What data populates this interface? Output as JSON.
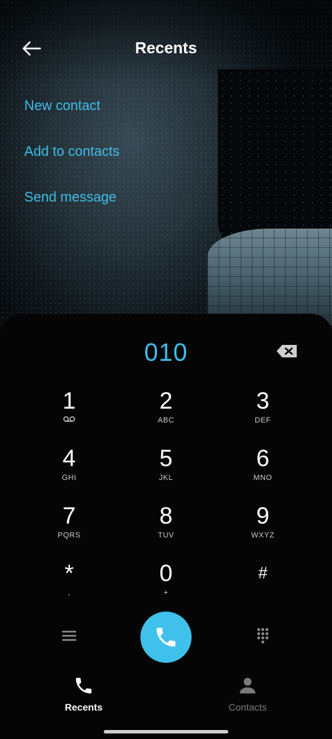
{
  "header": {
    "title": "Recents",
    "back_icon": "arrow-left-icon"
  },
  "menu": {
    "items": [
      {
        "label": "New contact"
      },
      {
        "label": "Add to contacts"
      },
      {
        "label": "Send message"
      }
    ]
  },
  "dialer": {
    "number": "010",
    "backspace_icon": "backspace-icon",
    "keys": [
      {
        "digit": "1",
        "letters": ""
      },
      {
        "digit": "2",
        "letters": "ABC"
      },
      {
        "digit": "3",
        "letters": "DEF"
      },
      {
        "digit": "4",
        "letters": "GHI"
      },
      {
        "digit": "5",
        "letters": "JKL"
      },
      {
        "digit": "6",
        "letters": "MNO"
      },
      {
        "digit": "7",
        "letters": "PQRS"
      },
      {
        "digit": "8",
        "letters": "TUV"
      },
      {
        "digit": "9",
        "letters": "WXYZ"
      },
      {
        "digit": "*",
        "letters": ","
      },
      {
        "digit": "0",
        "letters": "+"
      },
      {
        "digit": "#",
        "letters": ""
      }
    ],
    "menu_icon": "hamburger-menu-icon",
    "call_icon": "phone-icon",
    "keypad_icon": "dialpad-icon"
  },
  "bottom_nav": {
    "recents": {
      "label": "Recents",
      "icon": "phone-icon"
    },
    "contacts": {
      "label": "Contacts",
      "icon": "person-icon"
    }
  },
  "colors": {
    "accent": "#3fbde6",
    "call_button": "#3fc1ec",
    "background": "#000000",
    "inactive": "#7a7a7a"
  }
}
